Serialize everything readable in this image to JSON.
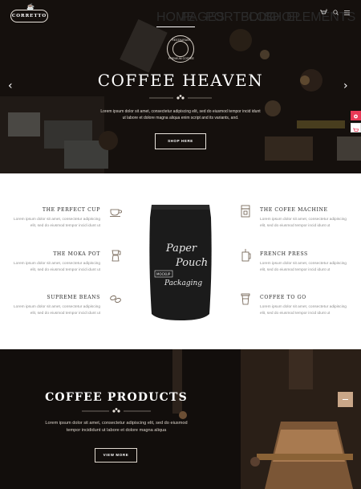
{
  "header": {
    "logo_text": "CORRETTO",
    "nav": [
      {
        "label": "HOME",
        "active": true
      },
      {
        "label": "PAGES",
        "active": false
      },
      {
        "label": "PORTFOLIO",
        "active": false
      },
      {
        "label": "BLOG",
        "active": false
      },
      {
        "label": "SHOP",
        "active": false
      },
      {
        "label": "ELEMENTS",
        "active": false
      }
    ],
    "cart_count": "0",
    "icons": [
      "cart-icon",
      "search-icon",
      "menu-icon"
    ]
  },
  "hero": {
    "badge_top": "RESTAURANT",
    "badge_bottom": "PREMIUM COFFEE",
    "title": "COFFEE HEAVEN",
    "text": "Lorem ipsum dolor sit amet, consectetur adipiscing elit, sed do eiusmod tempor incid idunt ut labore et dolore magna aliqua enim script and its variants, and.",
    "button": "SHOP HERE",
    "prev_icon": "chevron-left-icon",
    "next_icon": "chevron-right-icon"
  },
  "side_tabs": [
    "settings-icon",
    "cart-icon"
  ],
  "features": {
    "left": [
      {
        "title": "THE PERFECT CUP",
        "text": "Lorem ipsum dolor sit amet, consectetur adipiscing elit, sed do eiusmod tempor incid idunt ut",
        "icon": "cup-icon"
      },
      {
        "title": "THE MOKA POT",
        "text": "Lorem ipsum dolor sit amet, consectetur adipiscing elit, sed do eiusmod tempor incid idunt ut",
        "icon": "moka-pot-icon"
      },
      {
        "title": "SUPREME BEANS",
        "text": "Lorem ipsum dolor sit amet, consectetur adipiscing elit, sed do eiusmod tempor incid idunt ut",
        "icon": "beans-icon"
      }
    ],
    "right": [
      {
        "title": "THE COFEE MACHINE",
        "text": "Lorem ipsum dolor sit amet, consectetur adipiscing elit, sed do eiusmod tempor incid idunt ut",
        "icon": "coffee-machine-icon"
      },
      {
        "title": "FRENCH PRESS",
        "text": "Lorem ipsum dolor sit amet, consectetur adipiscing elit, sed do eiusmod tempor incid idunt ut",
        "icon": "french-press-icon"
      },
      {
        "title": "COFFEE TO GO",
        "text": "Lorem ipsum dolor sit amet, consectetur adipiscing elit, sed do eiusmod tempor incid idunt ut",
        "icon": "takeaway-cup-icon"
      }
    ],
    "pouch": {
      "line1": "Paper",
      "line2": "Pouch",
      "badge": "MOCKUP",
      "line3": "Packaging"
    }
  },
  "products": {
    "title": "COFFEE PRODUCTS",
    "text": "Lorem ipsum dolor sit amet, consectetur adipiscing elit, sed do eiusmod tempor incididunt ut labore et dolore magna aliqua",
    "button": "VIEW MORE"
  },
  "colors": {
    "accent": "#c9a688",
    "side_tab": "#e83a57",
    "dark": "#120d0b"
  }
}
